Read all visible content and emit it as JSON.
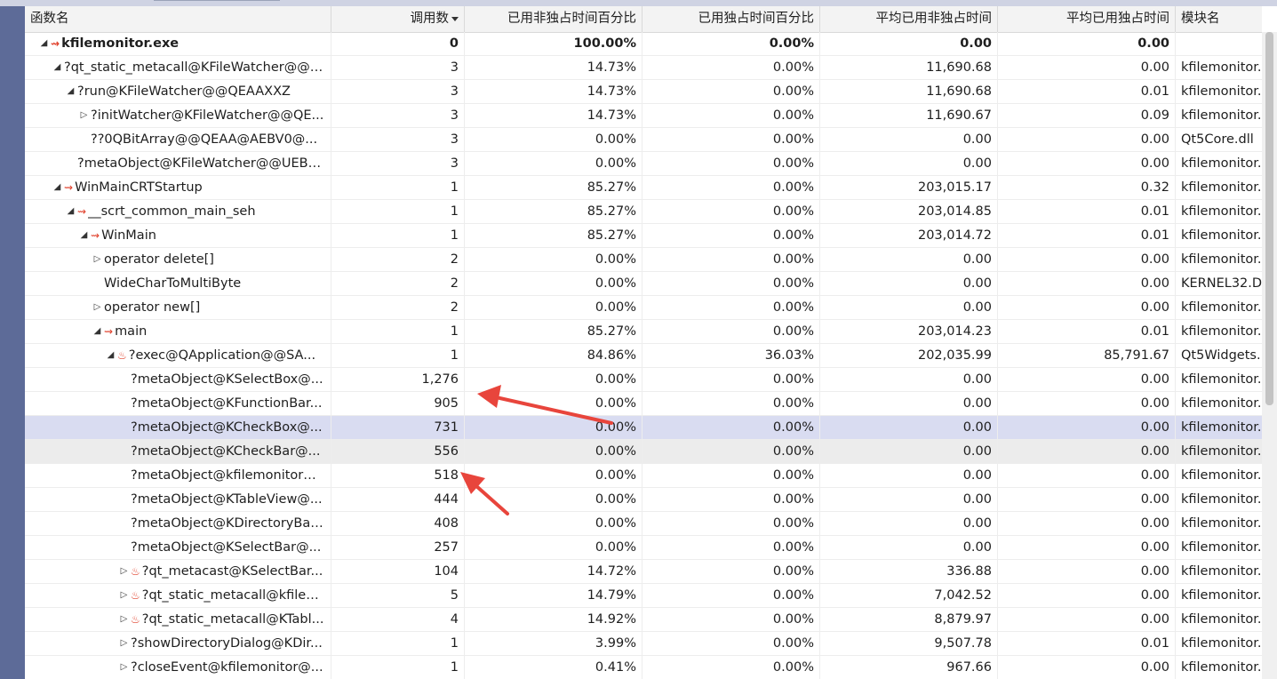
{
  "columns": {
    "function": "函数名",
    "calls": "调用数",
    "incl_pct": "已用非独占时间百分比",
    "excl_pct": "已用独占时间百分比",
    "avg_incl": "平均已用非独占时间",
    "avg_excl": "平均已用独占时间",
    "module": "模块名"
  },
  "sort": {
    "column": "calls",
    "direction": "descending"
  },
  "colors": {
    "hot_icon": "#e0402b",
    "annotation_arrow": "#e8453c",
    "selected_row": "#d9dcf1"
  },
  "rows": [
    {
      "depth": 0,
      "expander": "expanded",
      "icon": "hot-path-icon",
      "bold": true,
      "name": "kfilemonitor.exe",
      "calls": "0",
      "incl": "100.00%",
      "excl": "0.00%",
      "avg_incl": "0.00",
      "avg_excl": "0.00",
      "module": ""
    },
    {
      "depth": 1,
      "expander": "expanded",
      "icon": "",
      "bold": false,
      "name": "?qt_static_metacall@KFileWatcher@@C...",
      "calls": "3",
      "incl": "14.73%",
      "excl": "0.00%",
      "avg_incl": "11,690.68",
      "avg_excl": "0.00",
      "module": "kfilemonitor."
    },
    {
      "depth": 2,
      "expander": "expanded",
      "icon": "",
      "bold": false,
      "name": "?run@KFileWatcher@@QEAAXXZ",
      "calls": "3",
      "incl": "14.73%",
      "excl": "0.00%",
      "avg_incl": "11,690.68",
      "avg_excl": "0.01",
      "module": "kfilemonitor."
    },
    {
      "depth": 3,
      "expander": "collapsed",
      "icon": "",
      "bold": false,
      "name": "?initWatcher@KFileWatcher@@QE...",
      "calls": "3",
      "incl": "14.73%",
      "excl": "0.00%",
      "avg_incl": "11,690.67",
      "avg_excl": "0.09",
      "module": "kfilemonitor."
    },
    {
      "depth": 3,
      "expander": "none",
      "icon": "",
      "bold": false,
      "name": "??0QBitArray@@QEAA@AEBV0@...",
      "calls": "3",
      "incl": "0.00%",
      "excl": "0.00%",
      "avg_incl": "0.00",
      "avg_excl": "0.00",
      "module": "Qt5Core.dll"
    },
    {
      "depth": 2,
      "expander": "none",
      "icon": "",
      "bold": false,
      "name": "?metaObject@KFileWatcher@@UEBAP...",
      "calls": "3",
      "incl": "0.00%",
      "excl": "0.00%",
      "avg_incl": "0.00",
      "avg_excl": "0.00",
      "module": "kfilemonitor."
    },
    {
      "depth": 1,
      "expander": "expanded",
      "icon": "hot-path-icon",
      "bold": false,
      "name": "WinMainCRTStartup",
      "calls": "1",
      "incl": "85.27%",
      "excl": "0.00%",
      "avg_incl": "203,015.17",
      "avg_excl": "0.32",
      "module": "kfilemonitor."
    },
    {
      "depth": 2,
      "expander": "expanded",
      "icon": "hot-path-icon",
      "bold": false,
      "name": "__scrt_common_main_seh",
      "calls": "1",
      "incl": "85.27%",
      "excl": "0.00%",
      "avg_incl": "203,014.85",
      "avg_excl": "0.01",
      "module": "kfilemonitor."
    },
    {
      "depth": 3,
      "expander": "expanded",
      "icon": "hot-path-icon",
      "bold": false,
      "name": "WinMain",
      "calls": "1",
      "incl": "85.27%",
      "excl": "0.00%",
      "avg_incl": "203,014.72",
      "avg_excl": "0.01",
      "module": "kfilemonitor."
    },
    {
      "depth": 4,
      "expander": "collapsed",
      "icon": "",
      "bold": false,
      "name": "operator delete[]",
      "calls": "2",
      "incl": "0.00%",
      "excl": "0.00%",
      "avg_incl": "0.00",
      "avg_excl": "0.00",
      "module": "kfilemonitor."
    },
    {
      "depth": 4,
      "expander": "none",
      "icon": "",
      "bold": false,
      "name": "WideCharToMultiByte",
      "calls": "2",
      "incl": "0.00%",
      "excl": "0.00%",
      "avg_incl": "0.00",
      "avg_excl": "0.00",
      "module": "KERNEL32.DI"
    },
    {
      "depth": 4,
      "expander": "collapsed",
      "icon": "",
      "bold": false,
      "name": "operator new[]",
      "calls": "2",
      "incl": "0.00%",
      "excl": "0.00%",
      "avg_incl": "0.00",
      "avg_excl": "0.00",
      "module": "kfilemonitor."
    },
    {
      "depth": 4,
      "expander": "expanded",
      "icon": "hot-path-icon",
      "bold": false,
      "name": "main",
      "calls": "1",
      "incl": "85.27%",
      "excl": "0.00%",
      "avg_incl": "203,014.23",
      "avg_excl": "0.01",
      "module": "kfilemonitor."
    },
    {
      "depth": 5,
      "expander": "expanded",
      "icon": "hot-flame-icon",
      "bold": false,
      "name": "?exec@QApplication@@SA...",
      "calls": "1",
      "incl": "84.86%",
      "excl": "36.03%",
      "avg_incl": "202,035.99",
      "avg_excl": "85,791.67",
      "module": "Qt5Widgets."
    },
    {
      "depth": 6,
      "expander": "none",
      "icon": "",
      "bold": false,
      "name": "?metaObject@KSelectBox@...",
      "calls": "1,276",
      "incl": "0.00%",
      "excl": "0.00%",
      "avg_incl": "0.00",
      "avg_excl": "0.00",
      "module": "kfilemonitor."
    },
    {
      "depth": 6,
      "expander": "none",
      "icon": "",
      "bold": false,
      "name": "?metaObject@KFunctionBar...",
      "calls": "905",
      "incl": "0.00%",
      "excl": "0.00%",
      "avg_incl": "0.00",
      "avg_excl": "0.00",
      "module": "kfilemonitor."
    },
    {
      "depth": 6,
      "expander": "none",
      "icon": "",
      "bold": false,
      "state": "selected",
      "name": "?metaObject@KCheckBox@...",
      "calls": "731",
      "incl": "0.00%",
      "excl": "0.00%",
      "avg_incl": "0.00",
      "avg_excl": "0.00",
      "module": "kfilemonitor."
    },
    {
      "depth": 6,
      "expander": "none",
      "icon": "",
      "bold": false,
      "state": "hover",
      "name": "?metaObject@KCheckBar@...",
      "calls": "556",
      "incl": "0.00%",
      "excl": "0.00%",
      "avg_incl": "0.00",
      "avg_excl": "0.00",
      "module": "kfilemonitor."
    },
    {
      "depth": 6,
      "expander": "none",
      "icon": "",
      "bold": false,
      "name": "?metaObject@kfilemonitor@...",
      "calls": "518",
      "incl": "0.00%",
      "excl": "0.00%",
      "avg_incl": "0.00",
      "avg_excl": "0.00",
      "module": "kfilemonitor."
    },
    {
      "depth": 6,
      "expander": "none",
      "icon": "",
      "bold": false,
      "name": "?metaObject@KTableView@...",
      "calls": "444",
      "incl": "0.00%",
      "excl": "0.00%",
      "avg_incl": "0.00",
      "avg_excl": "0.00",
      "module": "kfilemonitor."
    },
    {
      "depth": 6,
      "expander": "none",
      "icon": "",
      "bold": false,
      "name": "?metaObject@KDirectoryBar...",
      "calls": "408",
      "incl": "0.00%",
      "excl": "0.00%",
      "avg_incl": "0.00",
      "avg_excl": "0.00",
      "module": "kfilemonitor."
    },
    {
      "depth": 6,
      "expander": "none",
      "icon": "",
      "bold": false,
      "name": "?metaObject@KSelectBar@...",
      "calls": "257",
      "incl": "0.00%",
      "excl": "0.00%",
      "avg_incl": "0.00",
      "avg_excl": "0.00",
      "module": "kfilemonitor."
    },
    {
      "depth": 6,
      "expander": "collapsed",
      "icon": "hot-flame-icon",
      "bold": false,
      "name": "?qt_metacast@KSelectBar...",
      "calls": "104",
      "incl": "14.72%",
      "excl": "0.00%",
      "avg_incl": "336.88",
      "avg_excl": "0.00",
      "module": "kfilemonitor."
    },
    {
      "depth": 6,
      "expander": "collapsed",
      "icon": "hot-flame-icon",
      "bold": false,
      "name": "?qt_static_metacall@kfilem...",
      "calls": "5",
      "incl": "14.79%",
      "excl": "0.00%",
      "avg_incl": "7,042.52",
      "avg_excl": "0.00",
      "module": "kfilemonitor."
    },
    {
      "depth": 6,
      "expander": "collapsed",
      "icon": "hot-flame-icon",
      "bold": false,
      "name": "?qt_static_metacall@KTabl...",
      "calls": "4",
      "incl": "14.92%",
      "excl": "0.00%",
      "avg_incl": "8,879.97",
      "avg_excl": "0.00",
      "module": "kfilemonitor."
    },
    {
      "depth": 6,
      "expander": "collapsed",
      "icon": "",
      "bold": false,
      "name": "?showDirectoryDialog@KDir...",
      "calls": "1",
      "incl": "3.99%",
      "excl": "0.00%",
      "avg_incl": "9,507.78",
      "avg_excl": "0.01",
      "module": "kfilemonitor."
    },
    {
      "depth": 6,
      "expander": "collapsed",
      "icon": "",
      "bold": false,
      "name": "?closeEvent@kfilemonitor@...",
      "calls": "1",
      "incl": "0.41%",
      "excl": "0.00%",
      "avg_incl": "967.66",
      "avg_excl": "0.00",
      "module": "kfilemonitor."
    }
  ]
}
